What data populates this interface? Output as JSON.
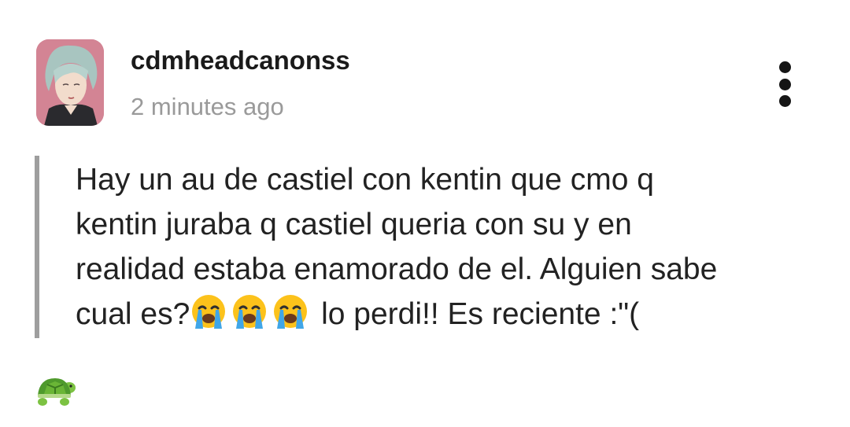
{
  "post": {
    "author": "cdmheadcanonss",
    "time": "2 minutes ago",
    "body_lines": [
      "Hay un au de castiel con kentin que cmo q",
      "kentin juraba q castiel queria con su y en",
      "realidad estaba enamorado de el. Alguien sabe"
    ],
    "last_line_start": "cual es?",
    "last_line_end": " lo perdi!! Es reciente :\"(",
    "emojis": [
      "loudly-crying-face-emoji",
      "loudly-crying-face-emoji",
      "loudly-crying-face-emoji"
    ]
  },
  "footer": {
    "reaction_icon": "turtle-emoji"
  },
  "icons": {
    "avatar": "user-avatar",
    "more": "more-vertical-icon"
  },
  "colors": {
    "text": "#222222",
    "muted": "#9a9a9a",
    "quote_bar": "#9e9e9e",
    "avatar_bg": "#d98fa0"
  }
}
